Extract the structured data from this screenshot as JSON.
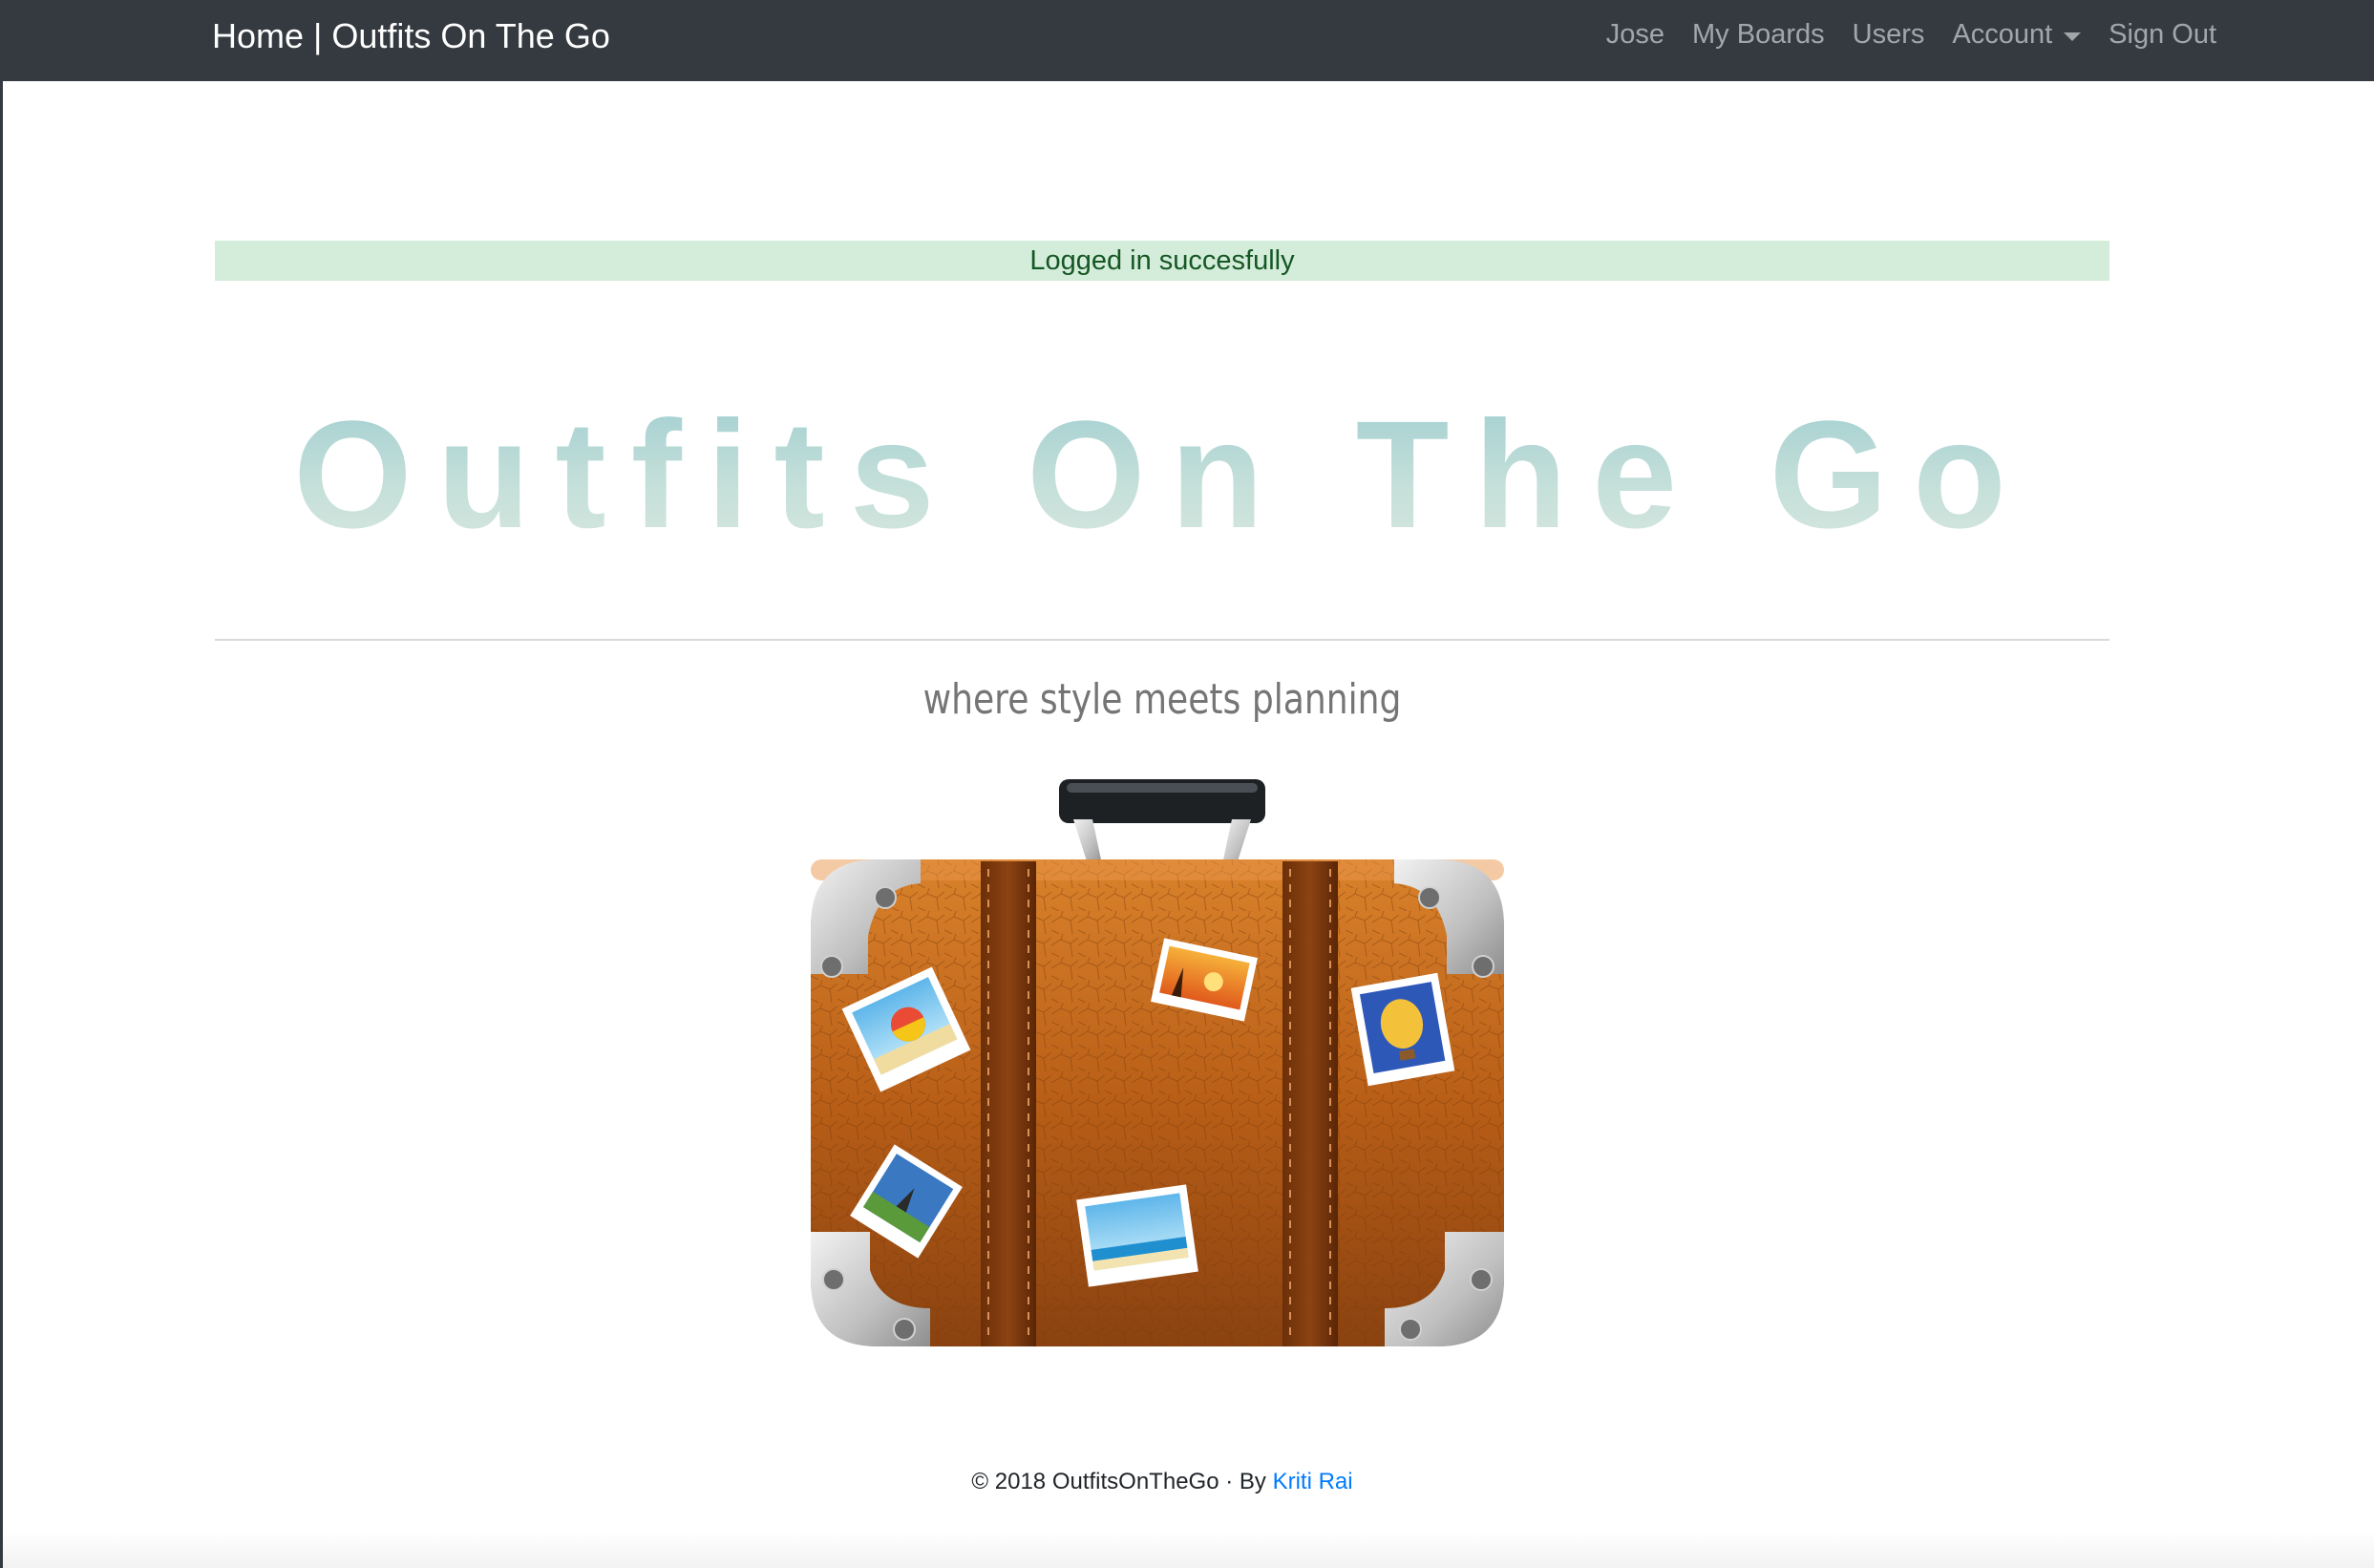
{
  "navbar": {
    "brand": "Home | Outfits On The Go",
    "links": [
      {
        "label": "Jose"
      },
      {
        "label": "My Boards"
      },
      {
        "label": "Users"
      },
      {
        "label": "Account"
      },
      {
        "label": "Sign Out"
      }
    ]
  },
  "alert": {
    "message": "Logged in succesfully",
    "color": "#155724",
    "background": "#d4edda"
  },
  "hero": {
    "title": "Outfits On The Go",
    "tagline": "where style meets planning",
    "image_icon": "suitcase-with-travel-photos"
  },
  "footer": {
    "copyright": "© 2018 OutfitsOnTheGo · By",
    "author": "Kriti Rai",
    "author_link_color": "#007bff"
  }
}
